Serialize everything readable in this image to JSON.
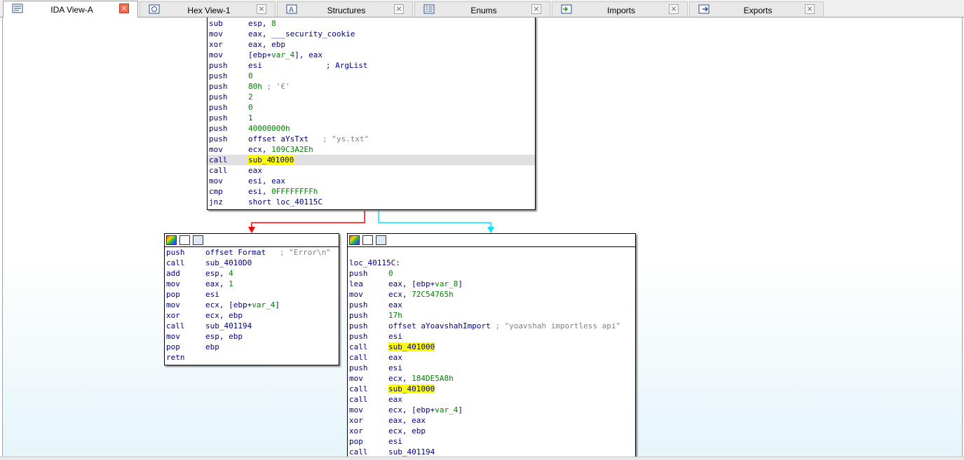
{
  "tabs": [
    {
      "label": "IDA View-A",
      "icon": "ida-view-icon",
      "active": true
    },
    {
      "label": "Hex View-1",
      "icon": "hex-view-icon",
      "active": false
    },
    {
      "label": "Structures",
      "icon": "structures-icon",
      "active": false
    },
    {
      "label": "Enums",
      "icon": "enums-icon",
      "active": false
    },
    {
      "label": "Imports",
      "icon": "imports-icon",
      "active": false
    },
    {
      "label": "Exports",
      "icon": "exports-icon",
      "active": false
    }
  ],
  "close_glyph": "×",
  "colors": {
    "edge_false": "#ff0000",
    "edge_true": "#00e5ff",
    "highlight": "#ffff00",
    "mnemonic": "#000080",
    "immediate": "#008000",
    "comment": "#808080"
  },
  "main_block": {
    "lines": [
      {
        "mn": "sub",
        "a": "esp, ",
        "n": "8"
      },
      {
        "mn": "mov",
        "a": "eax, ",
        "s": "___security_cookie"
      },
      {
        "mn": "xor",
        "a": "eax, ebp"
      },
      {
        "mn": "mov",
        "a": "[ebp+",
        "v": "var_4",
        "b": "], eax"
      },
      {
        "mn": "push",
        "a": "esi",
        "c": "; ArgList"
      },
      {
        "mn": "push",
        "n": "0"
      },
      {
        "mn": "push",
        "n": "80h",
        "c2": " ; '€'"
      },
      {
        "mn": "push",
        "n": "2"
      },
      {
        "mn": "push",
        "n": "0"
      },
      {
        "mn": "push",
        "n": "1"
      },
      {
        "mn": "push",
        "n": "40000000h"
      },
      {
        "mn": "push",
        "a": "offset aYsTxt",
        "c2": "   ; \"ys.txt\""
      },
      {
        "mn": "mov",
        "a": "ecx, ",
        "n": "109C3A2Eh"
      },
      {
        "mn": "call",
        "h1": "sub_4",
        "h2": "01000",
        "current": true
      },
      {
        "mn": "call",
        "a": "eax"
      },
      {
        "mn": "mov",
        "a": "esi, eax"
      },
      {
        "mn": "cmp",
        "a": "esi, ",
        "n": "0FFFFFFFFh"
      },
      {
        "mn": "jnz",
        "a": "short loc_40115C"
      }
    ]
  },
  "left_block": {
    "lines": [
      {
        "mn": "push",
        "a": "offset Format",
        "c2": "   ; \"Error\\n\""
      },
      {
        "mn": "call",
        "a": "sub_4010D0"
      },
      {
        "mn": "add",
        "a": "esp, ",
        "n": "4"
      },
      {
        "mn": "mov",
        "a": "eax, ",
        "n": "1"
      },
      {
        "mn": "pop",
        "a": "esi"
      },
      {
        "mn": "mov",
        "a": "ecx, [ebp+",
        "v": "var_4",
        "b": "]"
      },
      {
        "mn": "xor",
        "a": "ecx, ebp"
      },
      {
        "mn": "call",
        "a": "sub_401194"
      },
      {
        "mn": "mov",
        "a": "esp, ebp"
      },
      {
        "mn": "pop",
        "a": "ebp"
      },
      {
        "mn": "retn"
      }
    ]
  },
  "right_block": {
    "label": "loc_40115C:",
    "lines": [
      {
        "mn": "push",
        "n": "0"
      },
      {
        "mn": "lea",
        "a": "eax, [ebp+",
        "v": "var_8",
        "b": "]"
      },
      {
        "mn": "mov",
        "a": "ecx, ",
        "n": "72C54765h"
      },
      {
        "mn": "push",
        "a": "eax"
      },
      {
        "mn": "push",
        "n": "17h"
      },
      {
        "mn": "push",
        "a": "offset aYoavshahImport",
        "c2": " ; \"yoavshah importless api\""
      },
      {
        "mn": "push",
        "a": "esi"
      },
      {
        "mn": "call",
        "h": "sub_401000"
      },
      {
        "mn": "call",
        "a": "eax"
      },
      {
        "mn": "push",
        "a": "esi"
      },
      {
        "mn": "mov",
        "a": "ecx, ",
        "n": "184DE5A8h"
      },
      {
        "mn": "call",
        "h": "sub_401000"
      },
      {
        "mn": "call",
        "a": "eax"
      },
      {
        "mn": "mov",
        "a": "ecx, [ebp+",
        "v": "var_4",
        "b": "]"
      },
      {
        "mn": "xor",
        "a": "eax, eax"
      },
      {
        "mn": "xor",
        "a": "ecx, ebp"
      },
      {
        "mn": "pop",
        "a": "esi"
      },
      {
        "mn": "call",
        "a": "sub_401194"
      }
    ]
  }
}
